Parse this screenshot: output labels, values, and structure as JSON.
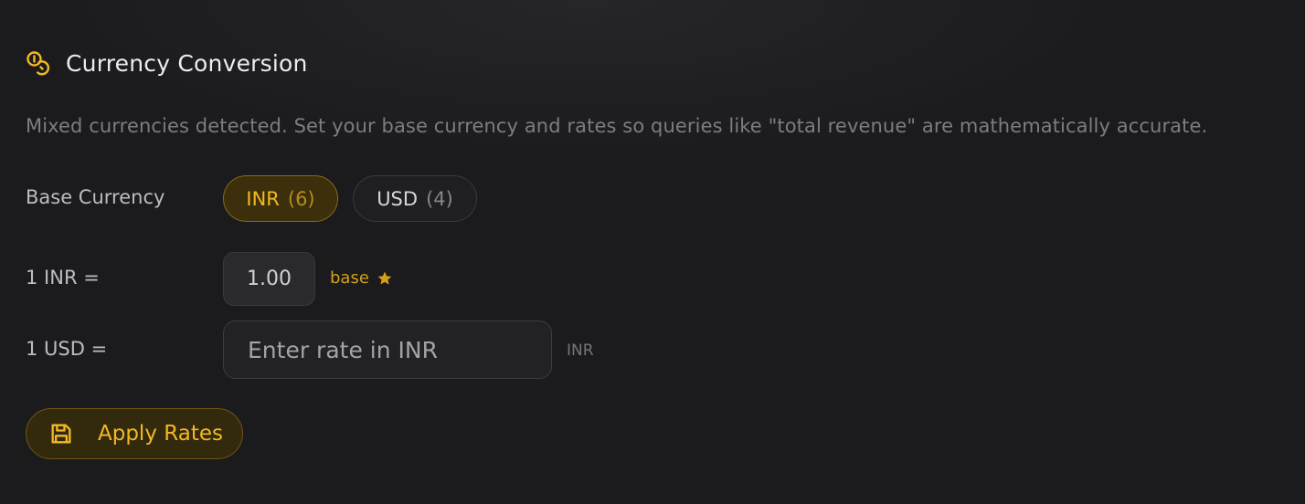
{
  "section": {
    "title": "Currency Conversion",
    "icon": "coins-icon",
    "description": "Mixed currencies detected. Set your base currency and rates so queries like \"total revenue\" are mathematically accurate."
  },
  "base_currency": {
    "label": "Base Currency",
    "options": [
      {
        "code": "INR",
        "count": "(6)",
        "selected": true
      },
      {
        "code": "USD",
        "count": "(4)",
        "selected": false
      }
    ]
  },
  "rates": [
    {
      "label": "1 INR =",
      "value": "1.00",
      "tag": "base",
      "tag_icon": "star-icon"
    },
    {
      "label": "1 USD =",
      "value": "",
      "placeholder": "Enter rate in INR",
      "unit": "INR"
    }
  ],
  "apply_button": {
    "label": "Apply Rates",
    "icon": "save-icon"
  },
  "colors": {
    "background": "#1b1b1d",
    "accent": "#f3b921",
    "accent_bg": "#3b2f0c",
    "muted_text": "#7d7d80"
  }
}
